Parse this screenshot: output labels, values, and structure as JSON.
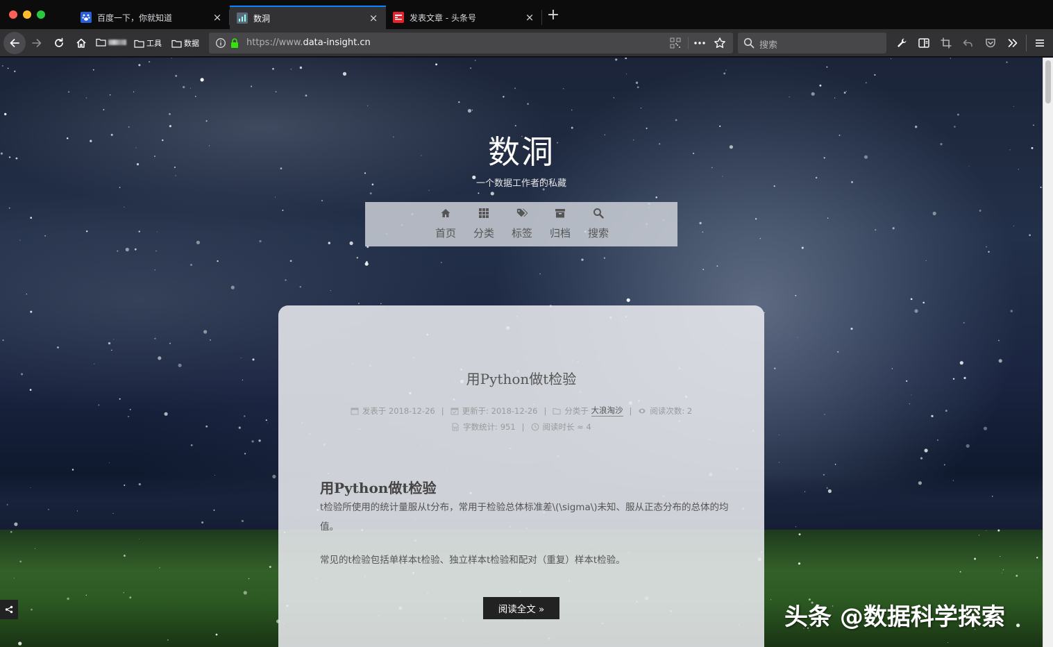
{
  "browser": {
    "tabs": [
      {
        "title": "百度一下，你就知道",
        "favicon": "baidu-paw-icon",
        "active": false
      },
      {
        "title": "数洞",
        "favicon": "data-insight-icon",
        "active": true
      },
      {
        "title": "发表文章 - 头条号",
        "favicon": "toutiao-icon",
        "active": false
      }
    ],
    "bookmarks": [
      {
        "label": "",
        "icon": "folder-icon"
      },
      {
        "label": "工具",
        "icon": "folder-icon"
      },
      {
        "label": "数据",
        "icon": "folder-icon"
      }
    ],
    "url": {
      "scheme": "https://www.",
      "host": "data-insight.cn"
    },
    "search_placeholder": "搜索",
    "new_tab_symbol": "+",
    "close_symbol": "×"
  },
  "site": {
    "title": "数洞",
    "subtitle": "一个数据工作者的私藏",
    "menu": [
      {
        "label": "首页",
        "icon": "home-icon"
      },
      {
        "label": "分类",
        "icon": "grid-icon"
      },
      {
        "label": "标签",
        "icon": "tags-icon"
      },
      {
        "label": "归档",
        "icon": "archive-icon"
      },
      {
        "label": "搜索",
        "icon": "search-icon"
      }
    ]
  },
  "post": {
    "title": "用Python做t检验",
    "meta": {
      "published_label": "发表于",
      "published": "2018-12-26",
      "updated_label": "更新于:",
      "updated": "2018-12-26",
      "category_label": "分类于",
      "category": "大浪淘沙",
      "views_label": "阅读次数:",
      "views": "2",
      "words_label": "字数统计:",
      "words": "951",
      "read_time_label": "阅读时长 ≈",
      "read_time": "4",
      "separator": "|"
    },
    "heading": "用Python做t检验",
    "paragraphs": [
      "t检验所使用的统计量服从t分布，常用于检验总体标准差\\(\\sigma\\)未知、服从正态分布的总体的均值。",
      "常见的t检验包括单样本t检验、独立样本t检验和配对（重复）样本t检验。"
    ],
    "read_more": "阅读全文 »"
  },
  "watermark": "头条 @数据科学探索",
  "colors": {
    "accent_tab": "#0a84ff",
    "menu_bg": "#d2d5dc",
    "card_bg": "#e8e9ee",
    "button_bg": "#222222"
  }
}
